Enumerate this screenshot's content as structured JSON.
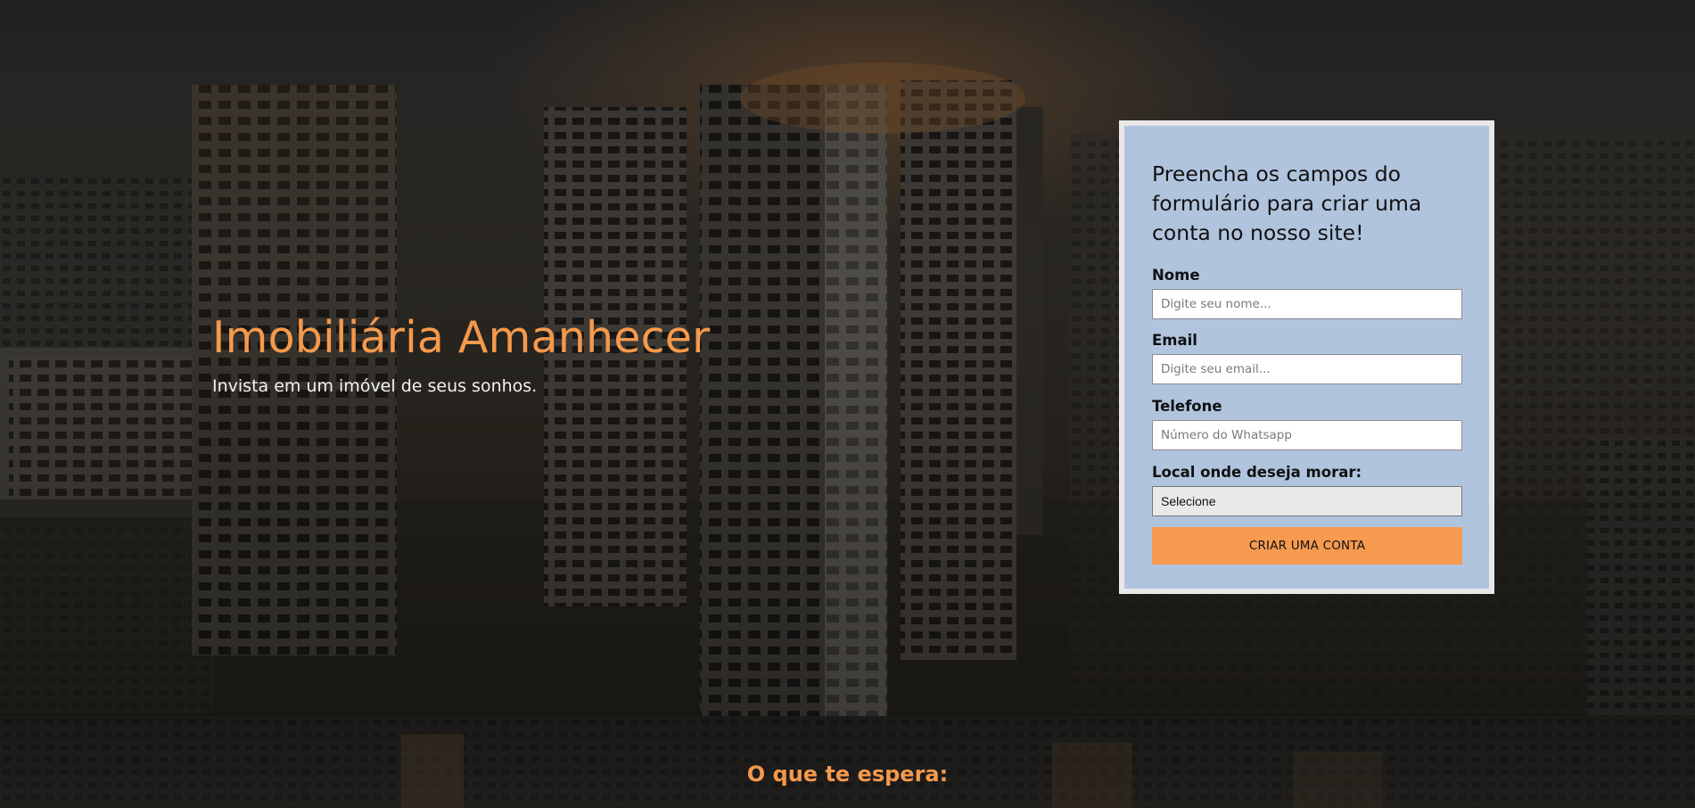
{
  "hero": {
    "title": "Imobiliária Amanhecer",
    "subtitle": "Invista em um imóvel de seus sonhos."
  },
  "signup_form": {
    "intro": "Preencha os campos do formulário para criar uma conta no nosso site!",
    "name_label": "Nome",
    "name_placeholder": "Digite seu nome...",
    "email_label": "Email",
    "email_placeholder": "Digite seu email...",
    "phone_label": "Telefone",
    "phone_placeholder": "Número do Whatsapp",
    "location_label": "Local onde deseja morar:",
    "location_selected": "Selecione",
    "submit_label": "CRIAR UMA CONTA"
  },
  "section2": {
    "title": "O que te espera:"
  },
  "colors": {
    "accent": "#f5994c",
    "card_background": "#b0c4de",
    "card_border": "#e8e8e8",
    "button": "#f59a4f"
  }
}
